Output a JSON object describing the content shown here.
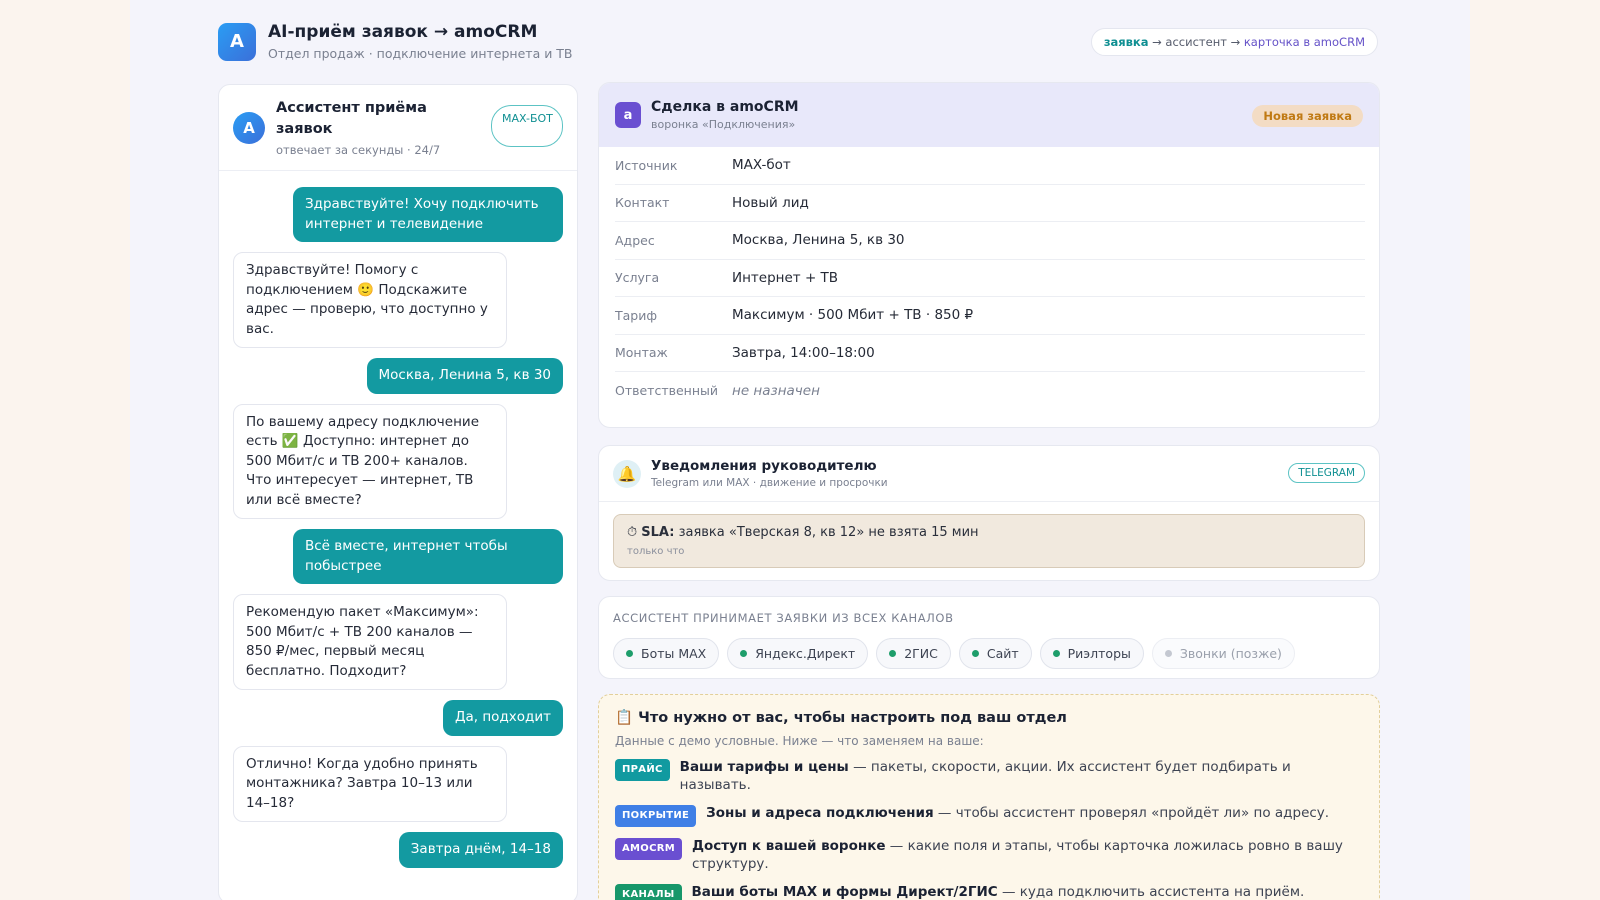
{
  "header": {
    "logo_letter": "A",
    "title": "AI-приём заявок → amoCRM",
    "subtitle": "Отдел продаж · подключение интернета и ТВ",
    "flow": {
      "step1": "заявка",
      "step2": " → ассистент → ",
      "step3": "карточка в amoCRM"
    }
  },
  "chat": {
    "avatar_letter": "A",
    "name": "Ассистент приёма заявок",
    "status": "отвечает за секунды · 24/7",
    "badge": "MAX-БОТ",
    "messages": [
      {
        "from": "user",
        "text": "Здравствуйте! Хочу подключить интернет и телевидение"
      },
      {
        "from": "bot",
        "text": "Здравствуйте! Помогу с подключением 🙂 Подскажите адрес — проверю, что доступно у вас."
      },
      {
        "from": "user",
        "text": "Москва, Ленина 5, кв 30"
      },
      {
        "from": "bot",
        "text": "По вашему адресу подключение есть ✅ Доступно: интернет до 500 Мбит/с и ТВ 200+ каналов. Что интересует — интернет, ТВ или всё вместе?"
      },
      {
        "from": "user",
        "text": "Всё вместе, интернет чтобы побыстрее"
      },
      {
        "from": "bot",
        "text": "Рекомендую пакет «Максимум»: 500 Мбит/с + ТВ 200 каналов — 850 ₽/мес, первый месяц бесплатно. Подходит?"
      },
      {
        "from": "user",
        "text": "Да, подходит"
      },
      {
        "from": "bot",
        "text": "Отлично! Когда удобно принять монтажника? Завтра 10–13 или 14–18?"
      },
      {
        "from": "user",
        "text": "Завтра днём, 14–18"
      }
    ]
  },
  "deal": {
    "icon_letter": "a",
    "title": "Сделка в amoCRM",
    "subtitle": "воронка «Подключения»",
    "badge": "Новая заявка",
    "rows": [
      {
        "key": "Источник",
        "value": "MAX-бот"
      },
      {
        "key": "Контакт",
        "value": "Новый лид"
      },
      {
        "key": "Адрес",
        "value": "Москва, Ленина 5, кв 30"
      },
      {
        "key": "Услуга",
        "value": "Интернет + ТВ"
      },
      {
        "key": "Тариф",
        "value": "Максимум · 500 Мбит + ТВ · 850 ₽"
      },
      {
        "key": "Монтаж",
        "value": "Завтра, 14:00–18:00"
      },
      {
        "key": "Ответственный",
        "value": "не назначен"
      }
    ]
  },
  "notifications": {
    "title": "Уведомления руководителю",
    "subtitle": "Telegram или MAX · движение и просрочки",
    "badge": "TELEGRAM",
    "alert": {
      "icon": "⏱",
      "label": "SLA:",
      "text": " заявка «Тверская 8, кв 12» не взята 15 мин",
      "time": "только что"
    }
  },
  "channels": {
    "title": "АССИСТЕНТ ПРИНИМАЕТ ЗАЯВКИ ИЗ ВСЕХ КАНАЛОВ",
    "items": [
      {
        "label": "Боты MAX",
        "active": true
      },
      {
        "label": "Яндекс.Директ",
        "active": true
      },
      {
        "label": "2ГИС",
        "active": true
      },
      {
        "label": "Сайт",
        "active": true
      },
      {
        "label": "Риэлторы",
        "active": true
      },
      {
        "label": "Звонки (позже)",
        "active": false
      }
    ]
  },
  "setup": {
    "icon": "📋",
    "title": "Что нужно от вас, чтобы настроить под ваш отдел",
    "subtitle": "Данные с демо условные. Ниже — что заменяем на ваше:",
    "items": [
      {
        "tag": "ПРАЙС",
        "bold": "Ваши тарифы и цены",
        "rest": " — пакеты, скорости, акции. Их ассистент будет подбирать и называть."
      },
      {
        "tag": "ПОКРЫТИЕ",
        "bold": "Зоны и адреса подключения",
        "rest": " — чтобы ассистент проверял «пройдёт ли» по адресу."
      },
      {
        "tag": "AMOCRM",
        "bold": "Доступ к вашей воронке",
        "rest": " — какие поля и этапы, чтобы карточка ложилась ровно в вашу структуру."
      },
      {
        "tag": "КАНАЛЫ",
        "bold": "Ваши боты MAX и формы Директ/2ГИС",
        "rest": " — куда подключить ассистента на приём."
      }
    ]
  }
}
